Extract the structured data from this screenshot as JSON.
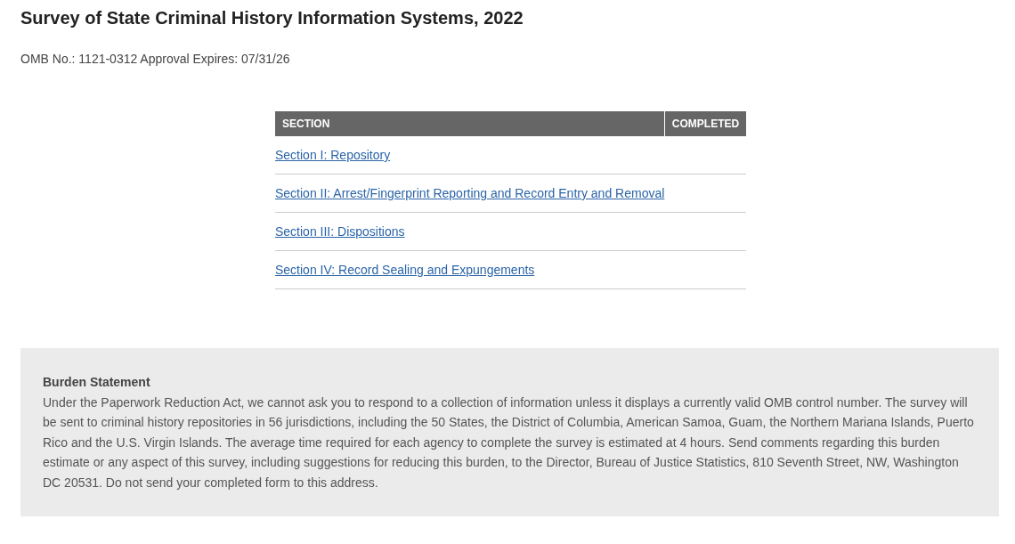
{
  "title": "Survey of State Criminal History Information Systems, 2022",
  "omb": "OMB No.: 1121-0312 Approval Expires: 07/31/26",
  "table": {
    "columns": [
      "SECTION",
      "COMPLETED"
    ],
    "rows": [
      {
        "section": "Section I: Repository"
      },
      {
        "section": "Section II: Arrest/Fingerprint Reporting and Record Entry and Removal"
      },
      {
        "section": "Section III: Dispositions"
      },
      {
        "section": "Section IV: Record Sealing and Expungements"
      }
    ]
  },
  "burden": {
    "heading": "Burden Statement",
    "text": "Under the Paperwork Reduction Act, we cannot ask you to respond to a collection of information unless it displays a currently valid OMB control number. The survey will be sent to criminal history repositories in 56 jurisdictions, including the 50 States, the District of Columbia, American Samoa, Guam, the Northern Mariana Islands, Puerto Rico and the U.S. Virgin Islands. The average time required for each agency to complete the survey is estimated at 4 hours. Send comments regarding this burden estimate or any aspect of this survey, including suggestions for reducing this burden, to the Director, Bureau of Justice Statistics, 810 Seventh Street, NW, Washington DC 20531. Do not send your completed form to this address."
  }
}
